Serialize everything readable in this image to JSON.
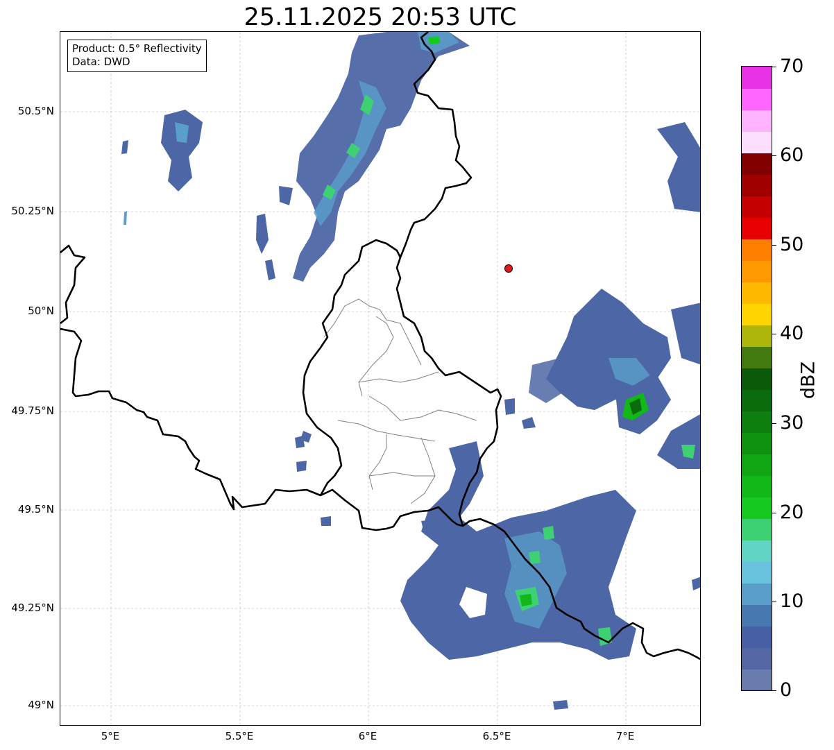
{
  "title": "25.11.2025 20:53 UTC",
  "info": {
    "product": "Product: 0.5° Reflectivity",
    "data": "Data: DWD"
  },
  "map": {
    "lon_range": [
      4.8,
      7.3
    ],
    "lat_range": [
      48.95,
      50.7
    ],
    "y_ticks": [
      "50.5°N",
      "50.25°N",
      "50°N",
      "49.75°N",
      "49.5°N",
      "49.25°N",
      "49°N"
    ],
    "x_ticks": [
      "5°E",
      "5.5°E",
      "6°E",
      "6.5°E",
      "7°E"
    ],
    "grid": "dashed",
    "radar_site": {
      "lon": 6.55,
      "lat": 50.11,
      "color": "#e41a1c"
    }
  },
  "colorbar": {
    "label": "dBZ",
    "ticks": [
      "70",
      "60",
      "50",
      "40",
      "30",
      "20",
      "10",
      "0"
    ],
    "colors": [
      "#6a7bae",
      "#5466a3",
      "#465fa5",
      "#4878b0",
      "#5a9fcb",
      "#68c2de",
      "#61d4c6",
      "#3ed174",
      "#15c921",
      "#12b817",
      "#10a512",
      "#0f9210",
      "#0d7f0e",
      "#0a6b0c",
      "#0a5a0a",
      "#437a10",
      "#adb40a",
      "#ffd500",
      "#ffb800",
      "#ff9900",
      "#ff7f00",
      "#e60000",
      "#c50000",
      "#a00000",
      "#800000",
      "#ffdfff",
      "#ffb3ff",
      "#ff66ff",
      "#e633e6"
    ]
  }
}
